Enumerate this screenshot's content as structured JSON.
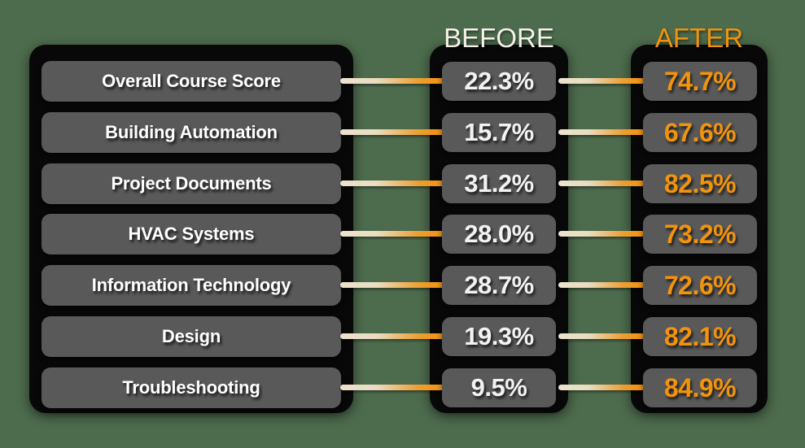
{
  "background_color": "#4d6b4d",
  "panel_color": "#080808",
  "chip_color": "#59595a",
  "accent_color": "#f2930c",
  "before_text_color": "#f2f2f2",
  "connector_gradient": [
    "#ece2cd",
    "#f0900f"
  ],
  "headers": {
    "before": "BEFORE",
    "after": "AFTER"
  },
  "rows": [
    {
      "label": "Overall Course Score",
      "before": "22.3%",
      "after": "74.7%"
    },
    {
      "label": "Building Automation",
      "before": "15.7%",
      "after": "67.6%"
    },
    {
      "label": "Project Documents",
      "before": "31.2%",
      "after": "82.5%"
    },
    {
      "label": "HVAC Systems",
      "before": "28.0%",
      "after": "73.2%"
    },
    {
      "label": "Information Technology",
      "before": "28.7%",
      "after": "72.6%"
    },
    {
      "label": "Design",
      "before": "19.3%",
      "after": "82.1%"
    },
    {
      "label": "Troubleshooting",
      "before": "9.5%",
      "after": "84.9%"
    }
  ],
  "chart_data": {
    "type": "table",
    "title": "",
    "categories": [
      "Overall Course Score",
      "Building Automation",
      "Project Documents",
      "HVAC Systems",
      "Information Technology",
      "Design",
      "Troubleshooting"
    ],
    "series": [
      {
        "name": "BEFORE",
        "values": [
          22.3,
          15.7,
          31.2,
          28.0,
          28.7,
          19.3,
          9.5
        ]
      },
      {
        "name": "AFTER",
        "values": [
          74.7,
          67.6,
          82.5,
          73.2,
          72.6,
          82.1,
          84.9
        ]
      }
    ],
    "unit": "%",
    "xlabel": "",
    "ylabel": "",
    "ylim": [
      0,
      100
    ],
    "grid": false,
    "legend_position": "top"
  }
}
